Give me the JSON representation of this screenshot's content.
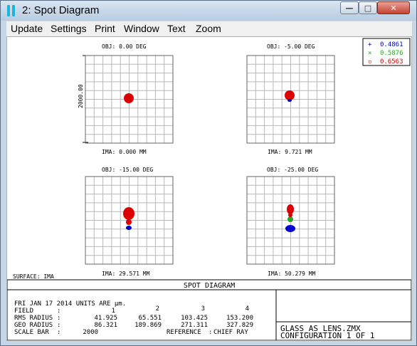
{
  "window": {
    "title": "2: Spot Diagram",
    "min_glyph": "—",
    "max_glyph": "□",
    "close_glyph": "✕"
  },
  "menu": [
    "Update",
    "Settings",
    "Print",
    "Window",
    "Text",
    "Zoom"
  ],
  "legend": [
    {
      "marker": "+",
      "label": "0.4861",
      "color": "#0000cc"
    },
    {
      "marker": "×",
      "label": "0.5876",
      "color": "#22aa22"
    },
    {
      "marker": "▫",
      "label": "0.6563",
      "color": "#dd0000"
    }
  ],
  "plots": [
    {
      "field_label": "OBJ: 0.00 DEG",
      "ima_label": "IMA: 0.000 MM"
    },
    {
      "field_label": "OBJ: -5.00 DEG",
      "ima_label": "IMA: 9.721 MM"
    },
    {
      "field_label": "OBJ: -15.00 DEG",
      "ima_label": "IMA: 29.571 MM"
    },
    {
      "field_label": "OBJ: -25.00 DEG",
      "ima_label": "IMA: 50.279 MM"
    }
  ],
  "scale_label": "2000.00",
  "surface_label": "SURFACE: IMA",
  "footer": {
    "title": "SPOT DIAGRAM",
    "date_line": "FRI JAN 17 2014  UNITS ARE µm.",
    "field_row": {
      "label": "FIELD",
      "values": [
        "1",
        "2",
        "3",
        "4"
      ]
    },
    "rms_row": {
      "label": "RMS RADIUS",
      "values": [
        "41.925",
        "65.551",
        "103.425",
        "153.200"
      ]
    },
    "geo_row": {
      "label": "GEO RADIUS",
      "values": [
        "86.321",
        "189.869",
        "271.311",
        "327.829"
      ]
    },
    "scale_bar": {
      "label": "SCALE BAR",
      "value": "2000"
    },
    "reference": {
      "label": "REFERENCE",
      "value": "CHIEF RAY"
    },
    "file_name": "GLASS_AS_LENS.ZMX",
    "configuration": "CONFIGURATION 1 OF 1"
  }
}
